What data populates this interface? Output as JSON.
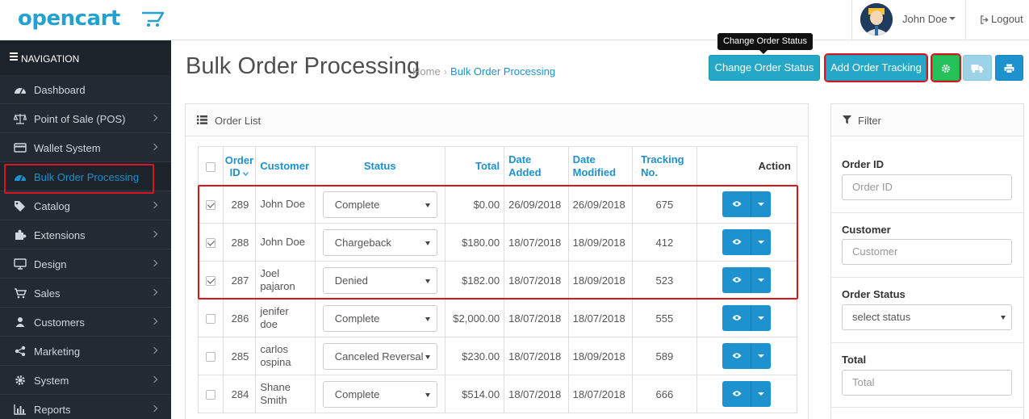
{
  "header": {
    "logo_text": "opencart",
    "user_name": "John Doe",
    "logout_label": "Logout"
  },
  "sidebar": {
    "title": "NAVIGATION",
    "items": [
      {
        "label": "Dashboard",
        "icon": "dashboard-icon",
        "has_children": false,
        "active": false
      },
      {
        "label": "Point of Sale (POS)",
        "icon": "balance-scale-icon",
        "has_children": true,
        "active": false
      },
      {
        "label": "Wallet System",
        "icon": "credit-card-icon",
        "has_children": true,
        "active": false
      },
      {
        "label": "Bulk Order Processing",
        "icon": "dashboard-icon",
        "has_children": false,
        "active": true
      },
      {
        "label": "Catalog",
        "icon": "tags-icon",
        "has_children": true,
        "active": false
      },
      {
        "label": "Extensions",
        "icon": "puzzle-icon",
        "has_children": true,
        "active": false
      },
      {
        "label": "Design",
        "icon": "monitor-icon",
        "has_children": true,
        "active": false
      },
      {
        "label": "Sales",
        "icon": "shopping-cart-icon",
        "has_children": true,
        "active": false
      },
      {
        "label": "Customers",
        "icon": "user-icon",
        "has_children": true,
        "active": false
      },
      {
        "label": "Marketing",
        "icon": "share-icon",
        "has_children": true,
        "active": false
      },
      {
        "label": "System",
        "icon": "cog-icon",
        "has_children": true,
        "active": false
      },
      {
        "label": "Reports",
        "icon": "bar-chart-icon",
        "has_children": true,
        "active": false
      }
    ]
  },
  "page": {
    "title": "Bulk Order Processing",
    "breadcrumb": {
      "home": "Home",
      "current": "Bulk Order Processing"
    },
    "tooltip": "Change Order Status",
    "buttons": {
      "change_status": "Change Order Status",
      "add_tracking": "Add Order Tracking"
    }
  },
  "order_list": {
    "heading": "Order List",
    "columns": {
      "order_id_line1": "Order",
      "order_id_line2": "ID",
      "customer": "Customer",
      "status": "Status",
      "total": "Total",
      "date_added_line1": "Date",
      "date_added_line2": "Added",
      "date_modified_line1": "Date",
      "date_modified_line2": "Modified",
      "tracking_line1": "Tracking",
      "tracking_line2": "No.",
      "action": "Action"
    },
    "rows": [
      {
        "checked": true,
        "order_id": "289",
        "customer_line1": "John Doe",
        "customer_line2": "",
        "status": "Complete",
        "total": "$0.00",
        "date_added": "26/09/2018",
        "date_modified": "26/09/2018",
        "tracking": "675"
      },
      {
        "checked": true,
        "order_id": "288",
        "customer_line1": "John Doe",
        "customer_line2": "",
        "status": "Chargeback",
        "total": "$180.00",
        "date_added": "18/07/2018",
        "date_modified": "18/09/2018",
        "tracking": "412"
      },
      {
        "checked": true,
        "order_id": "287",
        "customer_line1": "Joel",
        "customer_line2": "pajaron",
        "status": "Denied",
        "total": "$182.00",
        "date_added": "18/07/2018",
        "date_modified": "18/09/2018",
        "tracking": "523"
      },
      {
        "checked": false,
        "order_id": "286",
        "customer_line1": "jenifer",
        "customer_line2": "doe",
        "status": "Complete",
        "total": "$2,000.00",
        "date_added": "18/07/2018",
        "date_modified": "18/07/2018",
        "tracking": "555"
      },
      {
        "checked": false,
        "order_id": "285",
        "customer_line1": "carlos",
        "customer_line2": "ospina",
        "status": "Canceled Reversal",
        "total": "$230.00",
        "date_added": "18/07/2018",
        "date_modified": "18/09/2018",
        "tracking": "589"
      },
      {
        "checked": false,
        "order_id": "284",
        "customer_line1": "Shane",
        "customer_line2": "Smith",
        "status": "Complete",
        "total": "$514.00",
        "date_added": "18/07/2018",
        "date_modified": "18/07/2018",
        "tracking": "666"
      }
    ]
  },
  "filter": {
    "heading": "Filter",
    "order_id_label": "Order ID",
    "order_id_placeholder": "Order ID",
    "customer_label": "Customer",
    "customer_placeholder": "Customer",
    "status_label": "Order Status",
    "status_value": "select status",
    "total_label": "Total",
    "total_placeholder": "Total"
  },
  "colors": {
    "brand_blue": "#1e91cf",
    "info_button": "#25a8c7",
    "success_button": "#25c25a",
    "sidebar_bg": "#232a33",
    "highlight_red": "#d9161f"
  }
}
